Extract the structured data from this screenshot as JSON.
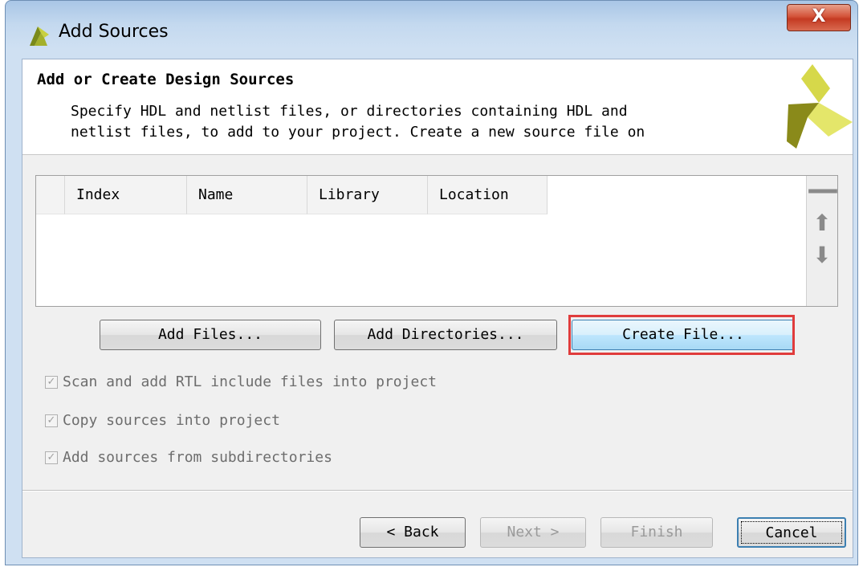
{
  "window": {
    "title": "Add Sources",
    "close_label": "X"
  },
  "header": {
    "title": "Add or Create Design Sources",
    "description": "Specify HDL and netlist files, or directories containing HDL and\nnetlist files, to add to your project. Create a new source file on"
  },
  "table": {
    "columns": [
      "Index",
      "Name",
      "Library",
      "Location"
    ],
    "rows": []
  },
  "side_tools": {
    "remove": "—",
    "move_up": "⬆",
    "move_down": "⬇"
  },
  "actions": {
    "add_files": "Add Files...",
    "add_directories": "Add Directories...",
    "create_file": "Create File..."
  },
  "options": [
    {
      "label": "Scan and add RTL include files into project",
      "checked": true,
      "enabled": false
    },
    {
      "label": "Copy sources into project",
      "checked": true,
      "enabled": false
    },
    {
      "label": "Add sources from subdirectories",
      "checked": true,
      "enabled": false
    }
  ],
  "footer": {
    "back": "< Back",
    "next": "Next >",
    "finish": "Finish",
    "cancel": "Cancel"
  },
  "colors": {
    "highlight": "#e03c3c",
    "logo_dark": "#8a8a1a",
    "logo_light": "#d6d84a"
  }
}
